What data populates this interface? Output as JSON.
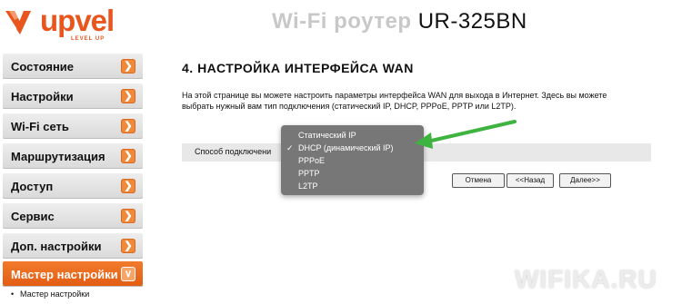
{
  "header": {
    "logo_text": "upvel",
    "logo_tagline": "LEVEL UP",
    "title_prefix": "Wi-Fi роутер",
    "title_model": "UR-325BN"
  },
  "sidebar": {
    "items": [
      {
        "label": "Состояние"
      },
      {
        "label": "Настройки"
      },
      {
        "label": "Wi-Fi сеть"
      },
      {
        "label": "Маршрутизация"
      },
      {
        "label": "Доступ"
      },
      {
        "label": "Сервис"
      },
      {
        "label": "Доп. настройки"
      },
      {
        "label": "Мастер настройки",
        "active": true
      }
    ],
    "subitem": "Мастер настройки"
  },
  "main": {
    "section_title": "4. НАСТРОЙКА ИНТЕРФЕЙСА WAN",
    "description": "На этой странице вы можете настроить параметры интерфейса WAN для выхода в Интернет. Здесь вы можете выбрать нужный вам тип подключения (статический IP, DHCP, PPPoE, PPTP или L2TP).",
    "connection_label": "Способ подключени",
    "buttons": {
      "cancel": "Отмена",
      "back": "<<Назад",
      "next": "Далее>>"
    }
  },
  "dropdown": {
    "options": [
      "Статический IP",
      "DHCP (динамический IP)",
      "PPPoE",
      "PPTP",
      "L2TP"
    ],
    "selected": "DHCP (динамический IP)",
    "check_mark": "✓"
  },
  "watermark": {
    "text": "WIFIKA.RU"
  },
  "colors": {
    "brand": "#e8561e",
    "accent_arrow": "#3fb33f",
    "active_menu": "#e8621a"
  }
}
